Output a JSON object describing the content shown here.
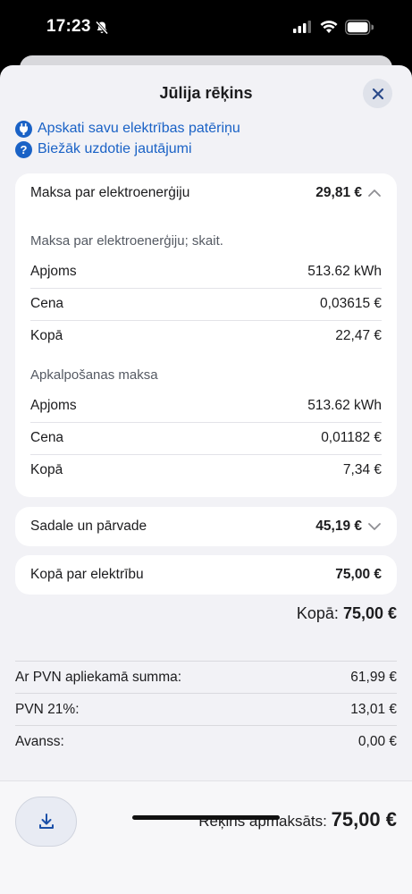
{
  "status_bar": {
    "time": "17:23"
  },
  "sheet": {
    "title": "Jūlija rēķins",
    "links": [
      {
        "label": "Apskati savu elektrības patēriņu",
        "icon": "plug-icon"
      },
      {
        "label": "Biežāk uzdotie jautājumi",
        "icon": "question-icon"
      }
    ]
  },
  "energy_card": {
    "label": "Maksa par elektroenerģiju",
    "amount": "29,81 €",
    "expanded": true,
    "group1": {
      "title": "Maksa par elektroenerģiju; skait.",
      "rows": [
        {
          "label": "Apjoms",
          "value": "513.62 kWh"
        },
        {
          "label": "Cena",
          "value": "0,03615 €"
        },
        {
          "label": "Kopā",
          "value": "22,47 €"
        }
      ]
    },
    "group2": {
      "title": "Apkalpošanas maksa",
      "rows": [
        {
          "label": "Apjoms",
          "value": "513.62 kWh"
        },
        {
          "label": "Cena",
          "value": "0,01182 €"
        },
        {
          "label": "Kopā",
          "value": "7,34 €"
        }
      ]
    }
  },
  "distribution_card": {
    "label": "Sadale un pārvade",
    "amount": "45,19 €",
    "expanded": false
  },
  "electricity_total_card": {
    "label": "Kopā par elektrību",
    "amount": "75,00 €"
  },
  "total": {
    "label": "Kopā:",
    "amount": "75,00 €"
  },
  "summary": [
    {
      "label": "Ar PVN apliekamā summa:",
      "value": "61,99 €"
    },
    {
      "label": "PVN 21%:",
      "value": "13,01 €"
    },
    {
      "label": "Avanss:",
      "value": "0,00 €"
    }
  ],
  "footer": {
    "paid_label": "Rēķins apmaksāts:",
    "paid_amount": "75,00 €"
  },
  "colors": {
    "accent": "#1a62c6",
    "background": "#f2f2f6",
    "card": "#ffffff"
  }
}
